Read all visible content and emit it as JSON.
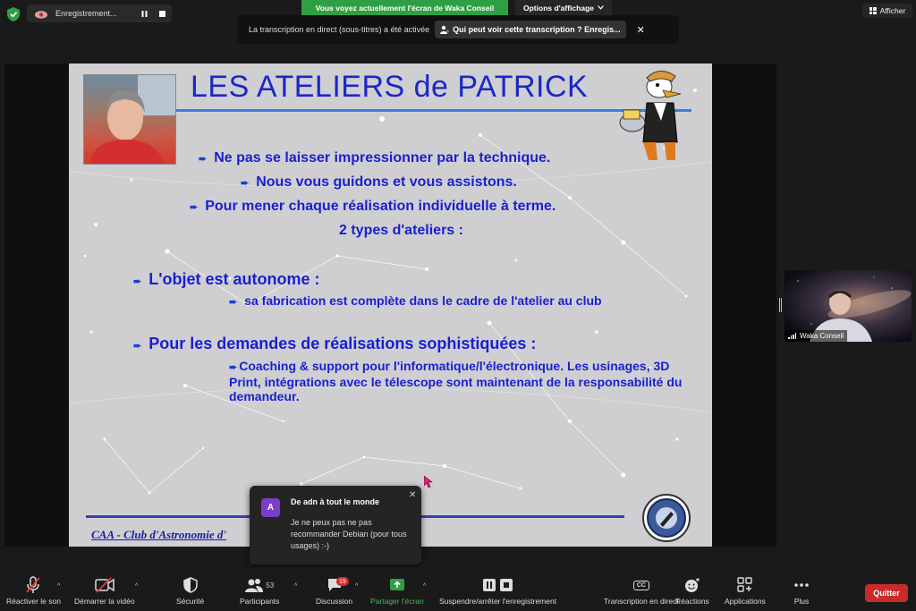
{
  "recording": {
    "label": "Enregistrement...",
    "pause_icon": "pause-icon",
    "stop_icon": "stop-icon"
  },
  "share_banner": "Vous voyez actuellement l'écran de Waka Conseil",
  "view_options": "Options d'affichage",
  "afficher": "Afficher",
  "transcription": {
    "text": "La transcription en direct (sous-titres) a été activée",
    "button": "Qui peut voir cette transcription ? Enregis...",
    "close": "✕"
  },
  "slide": {
    "title": "LES ATELIERS de PATRICK",
    "bullets": [
      "Ne pas se laisser impressionner par la technique.",
      "Nous vous guidons et vous assistons.",
      "Pour mener chaque réalisation individuelle à terme.",
      "2 types d'ateliers :",
      "L'objet est autonome :",
      "sa fabrication est complète dans le cadre de l'atelier au club",
      "Pour les demandes de réalisations sophistiquées :",
      "Coaching & support pour l'informatique/l'électronique. Les usinages, 3D Print, intégrations avec le télescope sont maintenant de la responsabilité du demandeur."
    ],
    "footer": "CAA - Club d'Astronomie d'"
  },
  "selfview": {
    "name": "Waka Conseil"
  },
  "chat_toast": {
    "avatar": "A",
    "from": "De adn à tout le monde",
    "message": "Je ne peux pas ne pas recommander Debian (pour tous usages) :-)",
    "close": "✕"
  },
  "toolbar": {
    "unmute": "Réactiver le son",
    "start_video": "Démarrer la vidéo",
    "security": "Sécurité",
    "participants": "Participants",
    "participants_count": "53",
    "chat": "Discussion",
    "chat_badge": "19",
    "share": "Partager l'écran",
    "record": "Suspendre/arrêter l'enregistrement",
    "transcript": "Transcription en direct",
    "cc": "CC",
    "reactions": "Réactions",
    "apps": "Applications",
    "more": "Plus",
    "quit": "Quitter"
  },
  "colors": {
    "accent_green": "#2ea043",
    "quit_red": "#c92a2a",
    "slide_text": "#1a1fd0"
  }
}
